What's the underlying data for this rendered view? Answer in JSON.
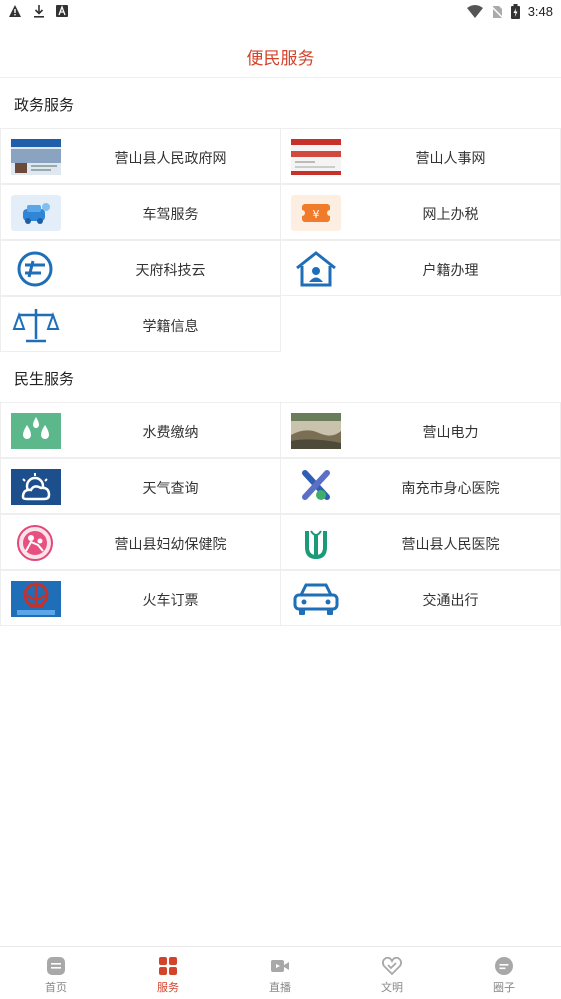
{
  "status": {
    "time": "3:48"
  },
  "header": {
    "title": "便民服务"
  },
  "sections": [
    {
      "title": "政务服务",
      "items": [
        {
          "label": "营山县人民政府网",
          "icon": "government-site-thumbnail"
        },
        {
          "label": "营山人事网",
          "icon": "personnel-site-thumbnail"
        },
        {
          "label": "车驾服务",
          "icon": "car-service-icon"
        },
        {
          "label": "网上办税",
          "icon": "tax-ticket-icon"
        },
        {
          "label": "天府科技云",
          "icon": "tianfu-cloud-logo"
        },
        {
          "label": "户籍办理",
          "icon": "household-house-icon"
        },
        {
          "label": "学籍信息",
          "icon": "scales-icon"
        }
      ]
    },
    {
      "title": "民生服务",
      "items": [
        {
          "label": "水费缴纳",
          "icon": "water-drops-icon"
        },
        {
          "label": "营山电力",
          "icon": "power-site-thumbnail"
        },
        {
          "label": "天气查询",
          "icon": "weather-icon"
        },
        {
          "label": "南充市身心医院",
          "icon": "hospital-logo"
        },
        {
          "label": "营山县妇幼保健院",
          "icon": "maternal-hospital-logo"
        },
        {
          "label": "营山县人民医院",
          "icon": "people-hospital-logo"
        },
        {
          "label": "火车订票",
          "icon": "railway-logo"
        },
        {
          "label": "交通出行",
          "icon": "car-icon"
        }
      ]
    }
  ],
  "tabs": [
    {
      "label": "首页",
      "icon": "home-icon",
      "active": false
    },
    {
      "label": "服务",
      "icon": "services-grid-icon",
      "active": true
    },
    {
      "label": "直播",
      "icon": "live-video-icon",
      "active": false
    },
    {
      "label": "文明",
      "icon": "heart-icon",
      "active": false
    },
    {
      "label": "圈子",
      "icon": "chat-circle-icon",
      "active": false
    }
  ],
  "colors": {
    "accent": "#d4422a",
    "border": "#eeeeee",
    "icon_blue": "#1e6fb8",
    "water_green": "#5cb88a",
    "tax_orange": "#f07b2a"
  }
}
